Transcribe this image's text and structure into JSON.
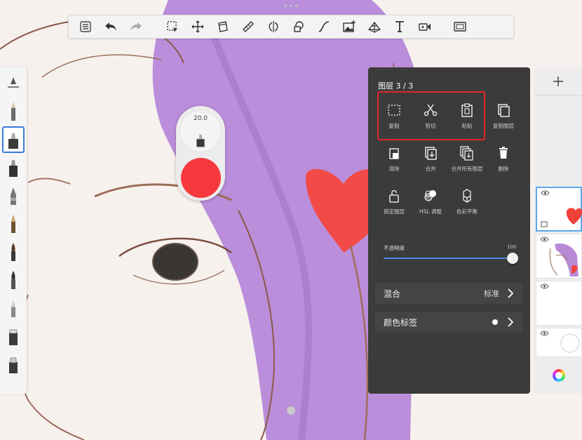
{
  "toolbar": {
    "icons": [
      "list-icon",
      "undo-icon",
      "redo-icon",
      "selection-icon",
      "transform-icon",
      "fill-icon",
      "ruler-icon",
      "symmetry-icon",
      "shapes-icon",
      "curve-icon",
      "image-icon",
      "perspective-icon",
      "text-icon",
      "video-icon",
      "fullscreen-icon"
    ]
  },
  "brushes": [
    "pencil",
    "inking-pen",
    "marker",
    "airbrush",
    "fineliner",
    "paintbrush",
    "wet-brush",
    "pointed-brush",
    "cone-brush",
    "eraser",
    "smudge"
  ],
  "puck": {
    "size": "20.0",
    "color": "#f5393d"
  },
  "layer_menu": {
    "title": "图层 3 / 3",
    "actions": [
      {
        "label": "复制",
        "icon": "copy-icon"
      },
      {
        "label": "剪切",
        "icon": "scissors-icon"
      },
      {
        "label": "粘贴",
        "icon": "paste-icon"
      },
      {
        "label": "复制图层",
        "icon": "duplicate-layer-icon"
      },
      {
        "label": "清除",
        "icon": "clear-icon"
      },
      {
        "label": "合并",
        "icon": "merge-icon"
      },
      {
        "label": "合并所有图层",
        "icon": "merge-all-icon"
      },
      {
        "label": "删除",
        "icon": "trash-icon"
      },
      {
        "label": "锁定图层",
        "icon": "lock-icon"
      },
      {
        "label": "HSL 调整",
        "icon": "hsl-icon"
      },
      {
        "label": "色彩平衡",
        "icon": "color-balance-icon"
      }
    ],
    "opacity_label": "不透明度",
    "opacity_value": "100",
    "opacity_level": 1.0,
    "blend_label": "混合",
    "blend_value": "标准",
    "color_tag_label": "颜色标签"
  },
  "layers": {
    "add_icon": "plus-icon",
    "items": [
      "heart-layer",
      "sketch-layer",
      "empty-layer",
      "background-layer"
    ],
    "accent": "#5da7ec"
  }
}
